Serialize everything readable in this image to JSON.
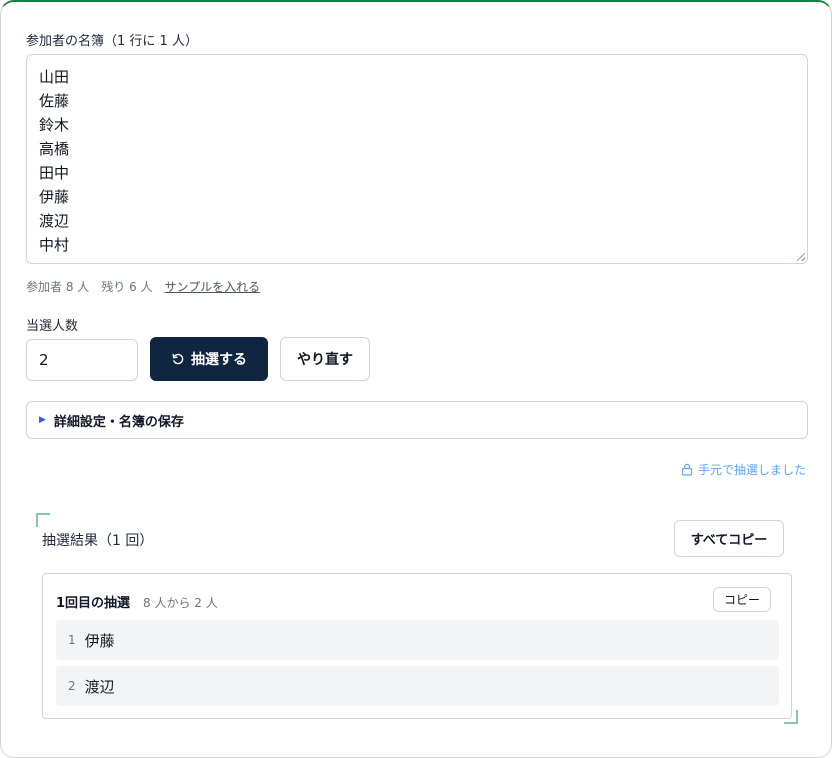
{
  "roster": {
    "label": "参加者の名簿（1 行に 1 人）",
    "names": [
      "山田",
      "佐藤",
      "鈴木",
      "高橋",
      "田中",
      "伊藤",
      "渡辺",
      "中村"
    ]
  },
  "stats": {
    "participants": "参加者 8 人",
    "remaining": "残り 6 人",
    "sample_link": "サンプルを入れる"
  },
  "winners_count": {
    "label": "当選人数",
    "value": "2"
  },
  "actions": {
    "draw_label": "抽選する",
    "redo_label": "やり直す"
  },
  "details": {
    "summary": "詳細設定・名簿の保存"
  },
  "local_note": "手元で抽選しました",
  "results": {
    "heading": "抽選結果（1 回）",
    "copy_all_label": "すべてコピー",
    "rounds": [
      {
        "title": "1回目の抽選",
        "subtitle": "8 人から 2 人",
        "copy_label": "コピー",
        "winners": [
          {
            "num": "1",
            "name": "伊藤"
          },
          {
            "num": "2",
            "name": "渡辺"
          }
        ]
      }
    ]
  },
  "colors": {
    "primary": "#0f2540",
    "accent_blue": "#2563eb",
    "note_blue": "#60a5fa",
    "top_border": "#15803d"
  }
}
